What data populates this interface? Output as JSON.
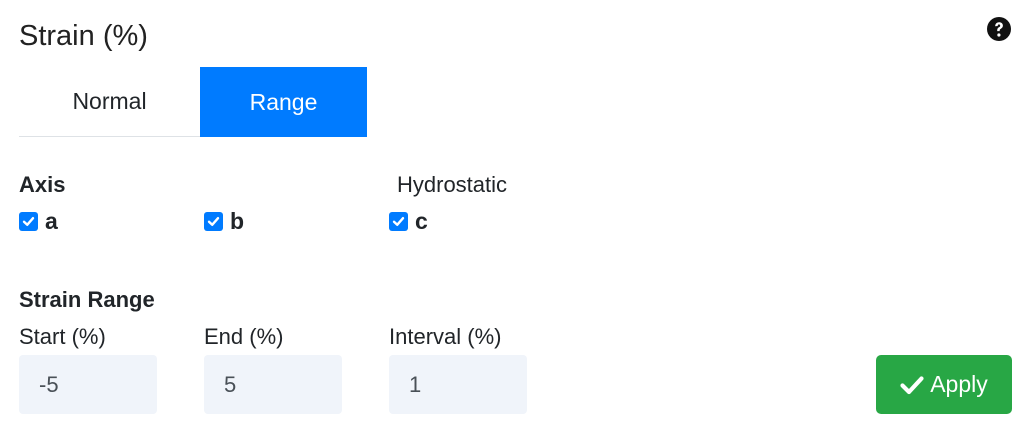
{
  "panel": {
    "title": "Strain (%)",
    "help_icon": "question-circle-icon"
  },
  "tabs": [
    {
      "label": "Normal",
      "active": false
    },
    {
      "label": "Range",
      "active": true
    }
  ],
  "axis": {
    "label": "Axis",
    "hydrostatic_label": "Hydrostatic",
    "options": [
      {
        "label": "a",
        "checked": true
      },
      {
        "label": "b",
        "checked": true
      },
      {
        "label": "c",
        "checked": true
      }
    ]
  },
  "strain_range": {
    "label": "Strain Range",
    "start": {
      "label": "Start (%)",
      "value": "-5"
    },
    "end": {
      "label": "End (%)",
      "value": "5"
    },
    "interval": {
      "label": "Interval (%)",
      "value": "1"
    }
  },
  "apply_button": {
    "label": "Apply",
    "icon": "check-icon"
  },
  "colors": {
    "primary": "#007bff",
    "success": "#28a745",
    "input_bg": "#f0f4fa"
  }
}
